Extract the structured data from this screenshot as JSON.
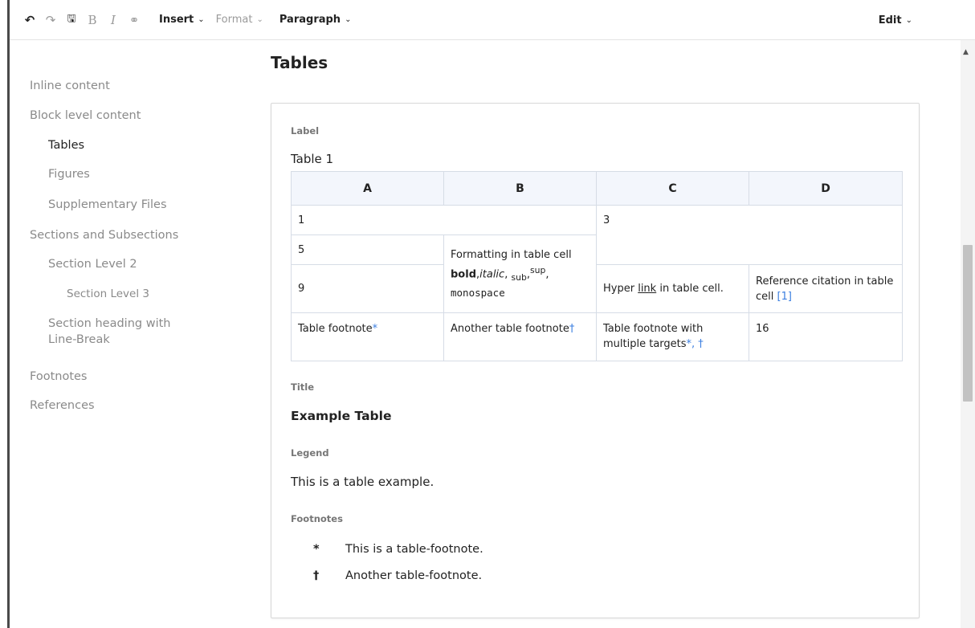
{
  "toolbar": {
    "undo_icon": "↶",
    "redo_icon": "↷",
    "save_icon": "🖫",
    "bold_icon": "B",
    "italic_icon": "I",
    "link_icon": "⚭",
    "insert": "Insert",
    "format": "Format",
    "paragraph": "Paragraph",
    "edit": "Edit",
    "chevron": "⌄"
  },
  "toc": {
    "items": [
      "Inline content",
      "Block level content",
      "Tables",
      "Figures",
      "Supplementary Files",
      "Sections and Subsections",
      "Section Level 2",
      "Section Level 3",
      "Section heading with",
      "Line-Break",
      "Footnotes",
      "References"
    ]
  },
  "main": {
    "section_title": "Tables",
    "label_label": "Label",
    "label_value": "Table 1",
    "title_label": "Title",
    "title_value": "Example Table",
    "legend_label": "Legend",
    "legend_value": "This is a table example.",
    "footnotes_label": "Footnotes",
    "footnotes": [
      {
        "mark": "*",
        "text": "This is a table-footnote."
      },
      {
        "mark": "†",
        "text": "Another table-footnote."
      }
    ]
  },
  "table": {
    "headers": [
      "A",
      "B",
      "C",
      "D"
    ],
    "r1_a": "1",
    "r1_c": "3",
    "r2_a": "5",
    "fmt_line1": "Formatting in table cell",
    "fmt_bold": "bold",
    "fmt_comma1": ",",
    "fmt_italic": "italic",
    "fmt_comma2": ", ",
    "fmt_sub": "sub",
    "fmt_comma3": ",",
    "fmt_sup": "sup",
    "fmt_comma4": ",",
    "fmt_mono": "monospace",
    "r3_a": "9",
    "hyper_pre": "Hyper ",
    "hyper_link": "link",
    "hyper_post": " in table cell.",
    "ref_text": "Reference citation in table cell ",
    "ref_cite": "[1]",
    "fn_a": "Table footnote",
    "fn_a_mark": "*",
    "fn_b": "Another table footnote",
    "fn_b_mark": "†",
    "fn_c": "Table footnote with multiple targets",
    "fn_c_mark": "*, †",
    "fn_d": "16"
  },
  "colors": {
    "accent_link": "#3c7fe0",
    "header_bg": "#f3f6fc"
  }
}
